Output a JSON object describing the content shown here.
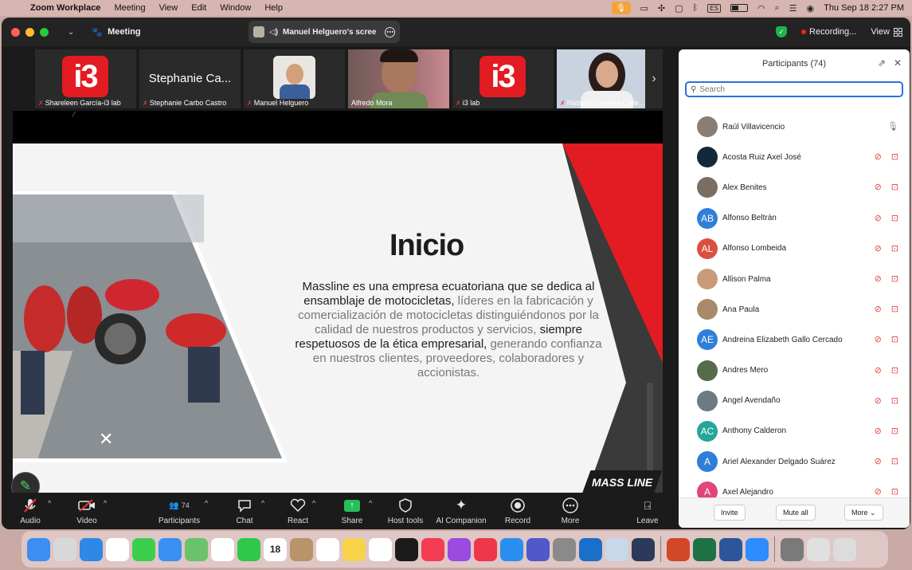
{
  "menubar": {
    "app": "Zoom Workplace",
    "items": [
      "Meeting",
      "View",
      "Edit",
      "Window",
      "Help"
    ],
    "keyboard": "ES",
    "datetime": "Thu Sep 18  2:27 PM"
  },
  "titlebar": {
    "meeting_label": "Meeting",
    "tab_title": "Manuel Helguero's scree",
    "recording": "Recording...",
    "view": "View"
  },
  "thumbnails": [
    {
      "name": "Shareleen García-i3 lab",
      "kind": "logo",
      "logo_text": "i3",
      "muted": true
    },
    {
      "name": "Stephanie Carbo Castro",
      "kind": "text",
      "display": "Stephanie Ca...",
      "muted": true
    },
    {
      "name": "Manuel Helguero",
      "kind": "photo",
      "muted": true
    },
    {
      "name": "Alfredo Mora",
      "kind": "video",
      "active": true,
      "muted": false
    },
    {
      "name": "i3 lab",
      "kind": "logo",
      "logo_text": "i3",
      "muted": true
    },
    {
      "name": "Natasha Lissette Calle...",
      "kind": "photo2",
      "muted": true
    }
  ],
  "slide": {
    "title": "Inicio",
    "body_parts": [
      {
        "t": "Massline es una empresa ecuatoriana que se dedica al ensamblaje de motocicletas,",
        "bold": true
      },
      {
        "t": " líderes en la fabricación y comercialización de motocicletas",
        "bold": false
      },
      {
        "t": " distinguiéndonos por la calidad de nuestros productos y servicios,",
        "bold": false
      },
      {
        "t": " siempre respetuosos de la ética empresarial,",
        "bold": true
      },
      {
        "t": " generando confianza en nuestros clientes, proveedores, colaboradores y accionistas.",
        "bold": false
      }
    ],
    "logo": "MASS LINE"
  },
  "toolbar": {
    "audio": "Audio",
    "video": "Video",
    "participants": "Participants",
    "participants_count": "74",
    "chat": "Chat",
    "react": "React",
    "share": "Share",
    "host_tools": "Host tools",
    "ai_companion": "AI Companion",
    "record": "Record",
    "more": "More",
    "leave": "Leave"
  },
  "panel": {
    "title": "Participants (74)",
    "search_placeholder": "Search",
    "participants": [
      {
        "name": "Raúl Villavicencio",
        "initials": "",
        "color": "#8a7d74",
        "photo": true,
        "mic": "on",
        "cam": "none"
      },
      {
        "name": "Acosta Ruiz Axel José",
        "initials": "",
        "color": "#13283b",
        "photo": true,
        "mic": "off",
        "cam": "off"
      },
      {
        "name": "Alex Benites",
        "initials": "",
        "color": "#7a6d62",
        "photo": true,
        "mic": "off",
        "cam": "off"
      },
      {
        "name": "Alfonso Beltrán",
        "initials": "AB",
        "color": "#2f7fd8",
        "photo": false,
        "mic": "off",
        "cam": "off"
      },
      {
        "name": "Alfonso Lombeida",
        "initials": "AL",
        "color": "#d9503f",
        "photo": false,
        "mic": "off",
        "cam": "off"
      },
      {
        "name": "Allison Palma",
        "initials": "",
        "color": "#c89a7a",
        "photo": true,
        "mic": "off",
        "cam": "off"
      },
      {
        "name": "Ana Paula",
        "initials": "",
        "color": "#a88a6a",
        "photo": true,
        "mic": "off",
        "cam": "off"
      },
      {
        "name": "Andreina Elizabeth Gallo Cercado",
        "initials": "AE",
        "color": "#2f7fd8",
        "photo": false,
        "mic": "off",
        "cam": "off"
      },
      {
        "name": "Andres Mero",
        "initials": "",
        "color": "#556b4a",
        "photo": true,
        "mic": "off",
        "cam": "off"
      },
      {
        "name": "Angel Avendaño",
        "initials": "",
        "color": "#6c7a82",
        "photo": true,
        "mic": "off",
        "cam": "off"
      },
      {
        "name": "Anthony Calderon",
        "initials": "AC",
        "color": "#26a69a",
        "photo": false,
        "mic": "off",
        "cam": "off"
      },
      {
        "name": "Ariel Alexander Delgado Suárez",
        "initials": "A",
        "color": "#2f7fd8",
        "photo": false,
        "mic": "off",
        "cam": "off"
      },
      {
        "name": "Axel Alejandro",
        "initials": "A",
        "color": "#e0457b",
        "photo": false,
        "mic": "off",
        "cam": "off"
      }
    ],
    "invite": "Invite",
    "mute_all": "Mute all",
    "more": "More"
  },
  "dock": {
    "calendar_day": "18",
    "apps": [
      "finder",
      "launchpad",
      "safari",
      "chrome",
      "messages",
      "mail",
      "maps",
      "photos",
      "facetime",
      "calendar",
      "contacts",
      "reminders",
      "notes",
      "freeform",
      "tv",
      "music",
      "podcasts",
      "news",
      "appstore",
      "teams",
      "settings",
      "outlook",
      "preview",
      "fes",
      "powerpoint",
      "excel",
      "word",
      "zoom",
      "screenshot",
      "files",
      "trash"
    ]
  }
}
